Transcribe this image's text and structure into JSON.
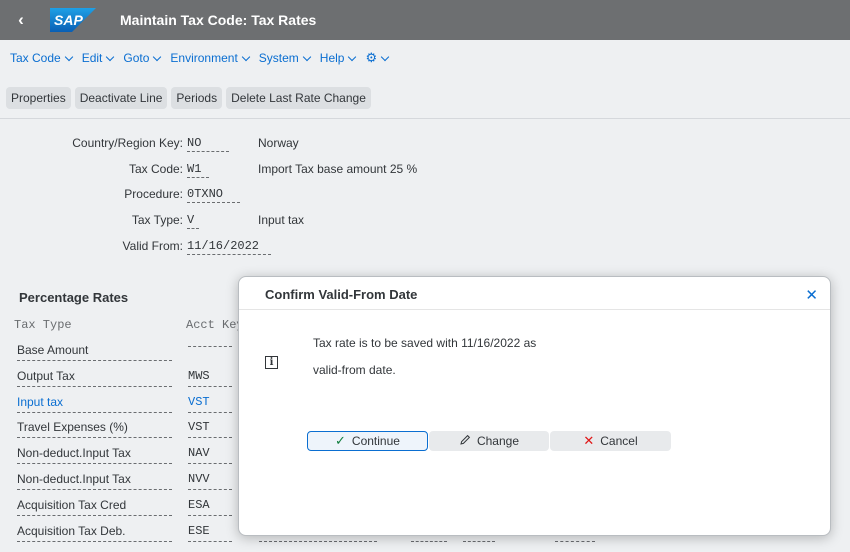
{
  "window": {
    "title": "Maintain Tax Code: Tax Rates",
    "back_icon": "chevron-left-icon",
    "logo_text": "SAP"
  },
  "menu": [
    {
      "label": "Tax Code"
    },
    {
      "label": "Edit"
    },
    {
      "label": "Goto"
    },
    {
      "label": "Environment"
    },
    {
      "label": "System"
    },
    {
      "label": "Help"
    }
  ],
  "menu_icons": {
    "settings": "⚙"
  },
  "toolbar": {
    "properties": "Properties",
    "deactivate_line": "Deactivate Line",
    "periods": "Periods",
    "delete_last_rate_change": "Delete Last Rate Change"
  },
  "header": {
    "country": {
      "label": "Country/Region Key:",
      "value": "NO",
      "desc": "Norway"
    },
    "tax_code": {
      "label": "Tax Code:",
      "value": "W1",
      "desc": "Import Tax base amount 25 %"
    },
    "procedure": {
      "label": "Procedure:",
      "value": "0TXNO"
    },
    "tax_type": {
      "label": "Tax Type:",
      "value": "V",
      "desc": "Input tax"
    },
    "valid_from": {
      "label": "Valid From:",
      "value": "11/16/2022"
    }
  },
  "rates": {
    "title": "Percentage Rates",
    "col_tax_type": "Tax Type",
    "col_acct_key": "Acct Key",
    "rows": [
      {
        "tax_type": "Base Amount",
        "acct_key": ""
      },
      {
        "tax_type": "Output Tax",
        "acct_key": "MWS"
      },
      {
        "tax_type": "Input tax",
        "acct_key": "VST"
      },
      {
        "tax_type": "Travel Expenses (%)",
        "acct_key": "VST"
      },
      {
        "tax_type": "Non-deduct.Input Tax",
        "acct_key": "NAV"
      },
      {
        "tax_type": "Non-deduct.Input Tax",
        "acct_key": "NVV"
      },
      {
        "tax_type": "Acquisition Tax Cred",
        "acct_key": "ESA"
      },
      {
        "tax_type": "Acquisition Tax Deb.",
        "acct_key": "ESE"
      }
    ]
  },
  "dialog": {
    "title": "Confirm Valid-From Date",
    "message_line1": "Tax rate is to be saved with 11/16/2022 as",
    "message_line2": "valid-from date.",
    "continue_label": "Continue",
    "change_label": "Change",
    "cancel_label": "Cancel"
  },
  "colors": {
    "accent": "#0a6ed1",
    "title_bar": "#6d6f71",
    "cancel_icon": "#e01515",
    "continue_icon": "#107e3e"
  }
}
